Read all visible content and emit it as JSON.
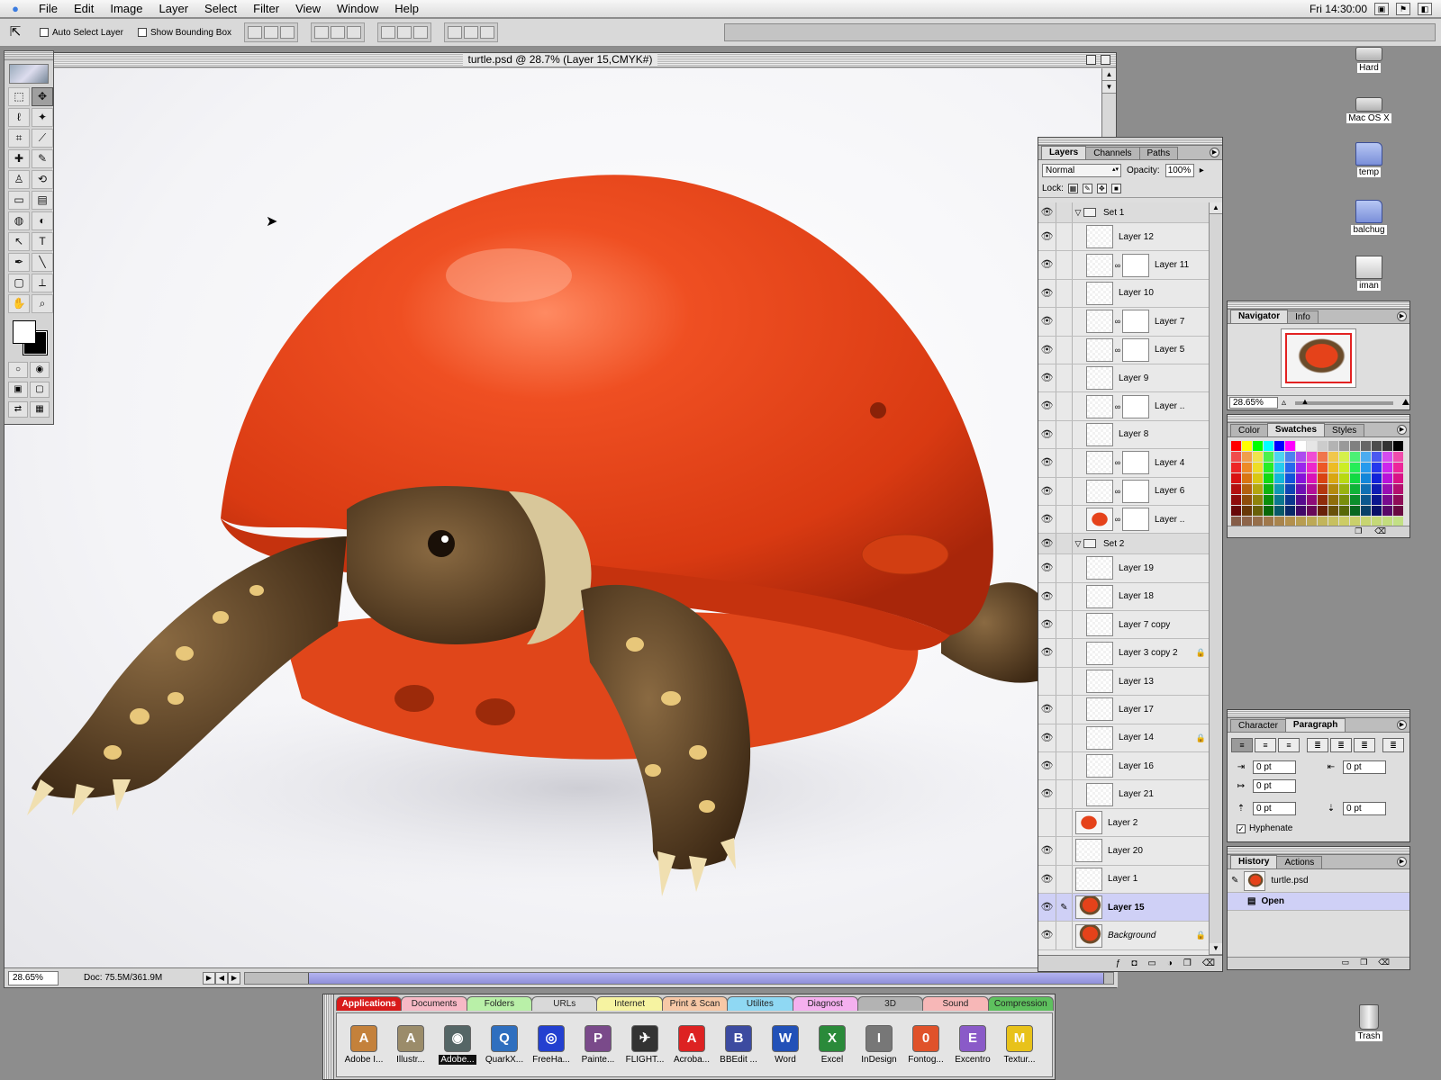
{
  "menubar": {
    "menus": [
      "File",
      "Edit",
      "Image",
      "Layer",
      "Select",
      "Filter",
      "View",
      "Window",
      "Help"
    ],
    "clock": "Fri 14:30:00"
  },
  "options": {
    "auto_select": "Auto Select Layer",
    "bounding_box": "Show Bounding Box"
  },
  "document": {
    "title": "turtle.psd @ 28.7% (Layer 15,CMYK#)",
    "zoom": "28.65%",
    "doc_size": "Doc: 75.5M/361.9M"
  },
  "layers_palette": {
    "tabs": [
      "Layers",
      "Channels",
      "Paths"
    ],
    "blend_mode": "Normal",
    "opacity_label": "Opacity:",
    "opacity_value": "100%",
    "lock_label": "Lock:",
    "rows": [
      {
        "name": "Set 1",
        "kind": "group",
        "visible": true
      },
      {
        "name": "Layer 12",
        "kind": "layer",
        "visible": true,
        "indent": true
      },
      {
        "name": "Layer 11",
        "kind": "masked",
        "visible": true,
        "indent": true
      },
      {
        "name": "Layer 10",
        "kind": "layer",
        "visible": true,
        "indent": true
      },
      {
        "name": "Layer 7",
        "kind": "masked",
        "visible": true,
        "indent": true
      },
      {
        "name": "Layer 5",
        "kind": "masked",
        "visible": true,
        "indent": true
      },
      {
        "name": "Layer 9",
        "kind": "layer",
        "visible": true,
        "indent": true
      },
      {
        "name": "Layer ..",
        "kind": "masked",
        "visible": true,
        "indent": true
      },
      {
        "name": "Layer 8",
        "kind": "layer",
        "visible": true,
        "indent": true
      },
      {
        "name": "Layer 4",
        "kind": "masked",
        "visible": true,
        "indent": true
      },
      {
        "name": "Layer 6",
        "kind": "masked",
        "visible": true,
        "indent": true
      },
      {
        "name": "Layer ..",
        "kind": "masked-helmet",
        "visible": true,
        "indent": true
      },
      {
        "name": "Set 2",
        "kind": "group",
        "visible": true
      },
      {
        "name": "Layer 19",
        "kind": "layer",
        "visible": true,
        "indent": true
      },
      {
        "name": "Layer 18",
        "kind": "layer",
        "visible": true,
        "indent": true
      },
      {
        "name": "Layer 7 copy",
        "kind": "layer",
        "visible": true,
        "indent": true
      },
      {
        "name": "Layer 3 copy 2",
        "kind": "layer",
        "visible": true,
        "indent": true,
        "locked": true
      },
      {
        "name": "Layer 13",
        "kind": "layer",
        "visible": false,
        "indent": true
      },
      {
        "name": "Layer 17",
        "kind": "layer",
        "visible": true,
        "indent": true
      },
      {
        "name": "Layer 14",
        "kind": "layer",
        "visible": true,
        "indent": true,
        "locked": true
      },
      {
        "name": "Layer 16",
        "kind": "layer",
        "visible": true,
        "indent": true
      },
      {
        "name": "Layer 21",
        "kind": "layer",
        "visible": true,
        "indent": true
      },
      {
        "name": "Layer 2",
        "kind": "helmet",
        "visible": false,
        "indent": false
      },
      {
        "name": "Layer 20",
        "kind": "layer",
        "visible": true,
        "indent": false
      },
      {
        "name": "Layer 1",
        "kind": "layer",
        "visible": true,
        "indent": false
      },
      {
        "name": "Layer 15",
        "kind": "tortoise",
        "visible": true,
        "indent": false,
        "selected": true
      },
      {
        "name": "Background",
        "kind": "tortoise",
        "visible": true,
        "indent": false,
        "locked": true,
        "italic": true
      }
    ]
  },
  "navigator": {
    "tabs": [
      "Navigator",
      "Info"
    ],
    "zoom": "28.65%",
    "zoom_level": 0.06
  },
  "swatches": {
    "tabs": [
      "Color",
      "Swatches",
      "Styles"
    ]
  },
  "paragraph": {
    "tabs": [
      "Character",
      "Paragraph"
    ],
    "left_indent": "0 pt",
    "right_indent": "0 pt",
    "first_line": "0 pt",
    "space_before": "0 pt",
    "space_after": "0 pt",
    "hyphenate": "Hyphenate"
  },
  "history": {
    "tabs": [
      "History",
      "Actions"
    ],
    "snapshot": "turtle.psd",
    "state": "Open"
  },
  "desktop": {
    "icons": [
      "Hard",
      "Mac OS X",
      "temp",
      "balchug",
      "iman",
      "Trash"
    ]
  },
  "launcher": {
    "tabs": [
      {
        "label": "Applications",
        "color": "#d81a1a",
        "active": true
      },
      {
        "label": "Documents",
        "color": "#f7b9c6"
      },
      {
        "label": "Folders",
        "color": "#b9f0a8"
      },
      {
        "label": "URLs",
        "color": "#d9d9d9"
      },
      {
        "label": "Internet",
        "color": "#f6f3a1"
      },
      {
        "label": "Print & Scan",
        "color": "#f7c8a6"
      },
      {
        "label": "Utilites",
        "color": "#8fd8f3"
      },
      {
        "label": "Diagnost",
        "color": "#f5b0ef"
      },
      {
        "label": "3D",
        "color": "#b3b3b3"
      },
      {
        "label": "Sound",
        "color": "#f7b7b7"
      },
      {
        "label": "Compression",
        "color": "#5ec05e"
      }
    ],
    "apps": [
      {
        "label": "Adobe I...",
        "color": "#c4813b",
        "glyph": "A"
      },
      {
        "label": "Illustr...",
        "color": "#9b8c6a",
        "glyph": "A"
      },
      {
        "label": "Adobe...",
        "color": "#566",
        "glyph": "◉",
        "running": true
      },
      {
        "label": "QuarkX...",
        "color": "#2f6fbf",
        "glyph": "Q"
      },
      {
        "label": "FreeHa...",
        "color": "#2340d0",
        "glyph": "◎"
      },
      {
        "label": "Painte...",
        "color": "#7a4a8a",
        "glyph": "P"
      },
      {
        "label": "FLIGHT...",
        "color": "#333",
        "glyph": "✈"
      },
      {
        "label": "Acroba...",
        "color": "#d22",
        "glyph": "A"
      },
      {
        "label": "BBEdit ...",
        "color": "#3c4ba0",
        "glyph": "B"
      },
      {
        "label": "Word",
        "color": "#2251b8",
        "glyph": "W"
      },
      {
        "label": "Excel",
        "color": "#2a8a3a",
        "glyph": "X"
      },
      {
        "label": "InDesign",
        "color": "#777",
        "glyph": "I"
      },
      {
        "label": "Fontog...",
        "color": "#e0522a",
        "glyph": "0"
      },
      {
        "label": "Excentro",
        "color": "#8a5ac8",
        "glyph": "E"
      },
      {
        "label": "Textur...",
        "color": "#e8c21a",
        "glyph": "M"
      }
    ]
  },
  "colors": {
    "selection": "#cfd0f6",
    "helmet": "#e5421a"
  }
}
